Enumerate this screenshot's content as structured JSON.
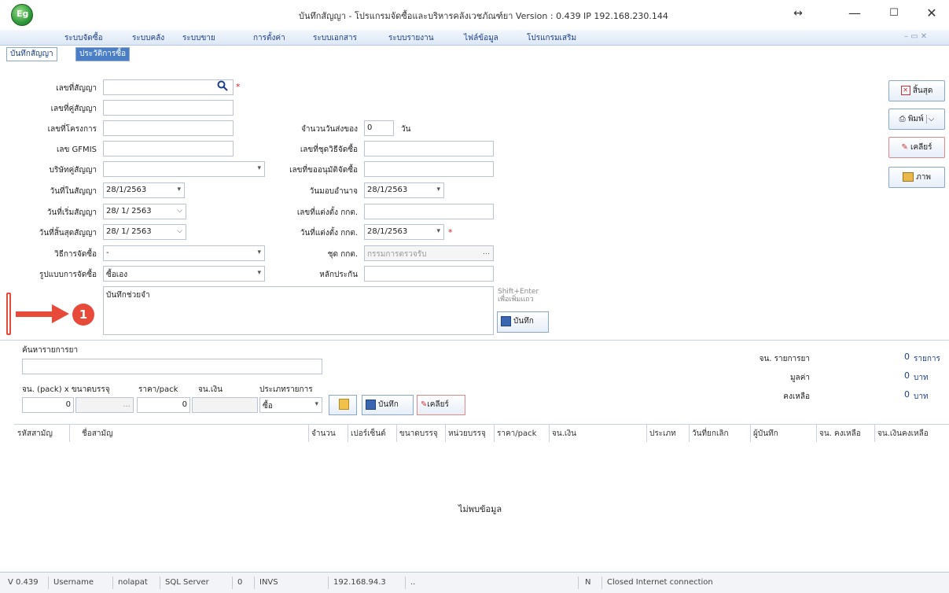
{
  "window": {
    "title": "บันทึกสัญญา - โปรแกรมจัดซื้อและบริหารคลังเวชภัณฑ์ยา Version : 0.439 IP 192.168.230.144",
    "icon_text": "Eg",
    "min": "—",
    "max": "☐",
    "close": "✕",
    "resize": "↔"
  },
  "menu": [
    "ระบบจัดซื้อ",
    "ระบบคลัง",
    "ระบบขาย",
    "การตั้งค่า",
    "ระบบเอกสาร",
    "ระบบรายงาน",
    "ไฟล์ข้อมูล",
    "โปรแกรมเสริม"
  ],
  "menu_controls": "– ▭ ✕",
  "tabs": [
    "บันทึกสัญญา",
    "ประวัติการซื้อ"
  ],
  "form": {
    "contract_no": {
      "label": "เลขที่สัญญา",
      "value": ""
    },
    "pair_contract": {
      "label": "เลขที่คู่สัญญา",
      "value": ""
    },
    "project_no": {
      "label": "เลขที่โครงการ",
      "value": ""
    },
    "gfmis": {
      "label": "เลข GFMIS",
      "value": ""
    },
    "company": {
      "label": "บริษัทคู่สัญญา",
      "value": ""
    },
    "contract_date": {
      "label": "วันที่ในสัญญา",
      "value": "28/1/2563"
    },
    "start_date": {
      "label": "วันที่เริ่มสัญญา",
      "value": "28/ 1/ 2563"
    },
    "end_date": {
      "label": "วันที่สิ้นสุดสัญญา",
      "value": "28/ 1/ 2563"
    },
    "method": {
      "label": "วิธีการจัดซื้อ",
      "value": "-"
    },
    "format": {
      "label": "รูปแบบการจัดซื้อ",
      "value": "ซื้อเอง"
    },
    "delivery_days": {
      "label": "จำนวนวันส่งของ",
      "value": "0",
      "unit": "วัน"
    },
    "procure_no": {
      "label": "เลขที่ชุดวิธีจัดซื้อ",
      "value": ""
    },
    "approve_no": {
      "label": "เลขที่ขออนุมัติจัดซื้อ",
      "value": ""
    },
    "approve_date": {
      "label": "วันมอบอำนาจ",
      "value": "28/1/2563"
    },
    "committee_no": {
      "label": "เลขที่แต่งตั้ง กกต.",
      "value": ""
    },
    "committee_date": {
      "label": "วันที่แต่งตั้ง กกต.",
      "value": "28/1/2563"
    },
    "committee_set": {
      "label": "ชุด กกต.",
      "value": "กรรมการตรวจรับ"
    },
    "guarantee": {
      "label": "หลักประกัน",
      "value": ""
    },
    "memo": {
      "value": "บันทึกช่วยจำ"
    },
    "shift_hint": "Shift+Enter\nเพื่อเพิ่มแถว",
    "save_label": "บันทึก"
  },
  "right_buttons": {
    "close": "สิ้นสุด",
    "print": "พิมพ์",
    "clear": "เคลียร์",
    "image": "ภาพ"
  },
  "annotation": {
    "number": "1"
  },
  "item": {
    "search_label": "ค้นหารายการยา",
    "qty_label": "จน. (pack) x ขนาดบรรจุ",
    "price_label": "ราคา/pack",
    "amount_label": "จน.เงิน",
    "type_label": "ประเภทรายการ",
    "qty": "0",
    "pack": "...",
    "price": "0",
    "amount": "",
    "type": "ซื้อ",
    "save": "บันทึก",
    "clear": "เคลียร์"
  },
  "summary": {
    "items_label": "จน. รายการยา",
    "items_value": "0",
    "items_unit": "รายการ",
    "value_label": "มูลค่า",
    "value_value": "0",
    "value_unit": "บาท",
    "remain_label": "คงเหลือ",
    "remain_value": "0",
    "remain_unit": "บาท"
  },
  "table": {
    "columns": [
      "รหัสสามัญ",
      "ชื่อสามัญ",
      "จำนวน",
      "เปอร์เซ็นต์",
      "ขนาดบรรจุ",
      "หน่วยบรรจุ",
      "ราคา/pack",
      "จน.เงิน",
      "ประเภท",
      "วันที่ยกเลิก",
      "ผู้บันทึก",
      "จน. คงเหลือ",
      "จน.เงินคงเหลือ"
    ],
    "empty": "ไม่พบข้อมูล"
  },
  "status": [
    "V 0.439",
    "Username",
    "nolapat",
    "SQL Server",
    "0",
    "INVS",
    "192.168.94.3",
    "..",
    "N",
    "Closed Internet connection"
  ],
  "colors": {
    "accent": "#1a3f8f",
    "arrow": "#e84a3a",
    "tab_active_bg": "#4a7fc8"
  }
}
